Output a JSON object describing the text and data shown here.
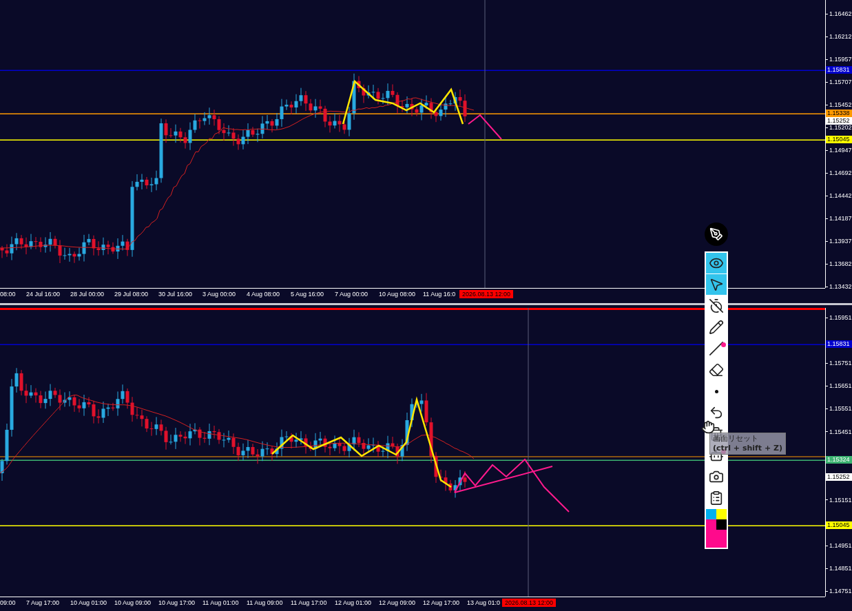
{
  "top_chart": {
    "price_ticks": [
      "1.16462",
      "1.16212",
      "1.15957",
      "1.15707",
      "1.15452",
      "1.15202",
      "1.14947",
      "1.14692",
      "1.14442",
      "1.14187",
      "1.13937",
      "1.13682",
      "1.13432"
    ],
    "price_markers": [
      {
        "label": "1.15831",
        "color": "#0000cc",
        "line": true
      },
      {
        "label": "1.15338",
        "color": "#ff9900",
        "line": true
      },
      {
        "label": "1.15252",
        "color": "#ffffff",
        "line": false
      },
      {
        "label": "1.15045",
        "color": "#ffff00",
        "line": true
      }
    ],
    "time_labels": [
      "08:00",
      "24 Jul 16:00",
      "28 Jul 00:00",
      "29 Jul 08:00",
      "30 Jul 16:00",
      "3 Aug 00:00",
      "4 Aug 08:00",
      "5 Aug 16:00",
      "7 Aug 00:00",
      "10 Aug 08:00",
      "11 Aug 16:0"
    ],
    "current_time": "2026.08.13 12:00"
  },
  "bottom_chart": {
    "price_ticks": [
      "1.15951",
      "1.15751",
      "1.15651",
      "1.15551",
      "1.15451",
      "1.15151",
      "1.14951",
      "1.14851",
      "1.14751"
    ],
    "price_markers": [
      {
        "label": "1.15831",
        "color": "#0000cc",
        "line": true
      },
      {
        "label": "1.15324",
        "color": "#3cb371",
        "line": true
      },
      {
        "label": "1.15252",
        "color": "#ffffff",
        "line": false
      },
      {
        "label": "1.15045",
        "color": "#ffff00",
        "line": true
      }
    ],
    "time_labels": [
      "09:00",
      "7 Aug 17:00",
      "10 Aug 01:00",
      "10 Aug 09:00",
      "10 Aug 17:00",
      "11 Aug 01:00",
      "11 Aug 09:00",
      "11 Aug 17:00",
      "12 Aug 01:00",
      "12 Aug 09:00",
      "12 Aug 17:00",
      "13 Aug 01:0"
    ],
    "current_time": "2026.08.13 12:00"
  },
  "toolbar": {
    "tools": [
      {
        "kind": "eye",
        "selected": true,
        "dot": false
      },
      {
        "kind": "cursor",
        "selected": true,
        "dot": false
      },
      {
        "kind": "timer",
        "selected": false,
        "dot": false
      },
      {
        "kind": "pencil",
        "selected": false,
        "dot": false
      },
      {
        "kind": "line",
        "selected": false,
        "dot": true
      },
      {
        "kind": "eraser",
        "selected": false,
        "dot": false
      },
      {
        "kind": "point",
        "selected": false,
        "dot": false
      },
      {
        "kind": "undo",
        "selected": false,
        "dot": false
      },
      {
        "kind": "trash",
        "selected": false,
        "dot": false
      },
      {
        "kind": "robot",
        "selected": false,
        "dot": true
      },
      {
        "kind": "camera",
        "selected": false,
        "dot": false
      },
      {
        "kind": "clipboard",
        "selected": false,
        "dot": false
      }
    ],
    "palette": [
      {
        "color": "#00b0f0"
      },
      {
        "color": "#ffff00"
      },
      {
        "color": "#ff0a8c"
      },
      {
        "color": "#000000"
      }
    ]
  },
  "tooltip": {
    "title": "画面リセット",
    "shortcut": "(ctrl + shift + Z)"
  }
}
